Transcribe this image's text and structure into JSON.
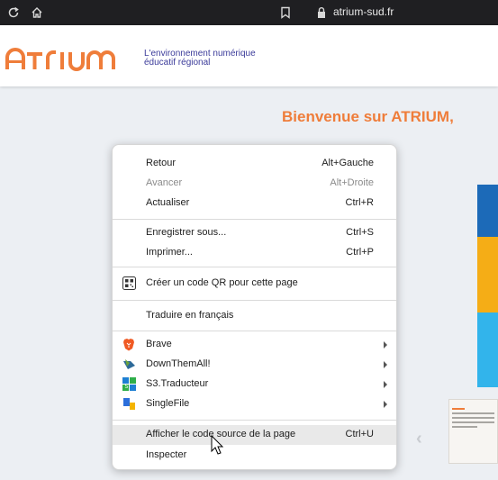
{
  "toolbar": {
    "url": "atrium-sud.fr",
    "icons": [
      "reload-icon",
      "home-icon",
      "bookmark-icon",
      "lock-icon"
    ]
  },
  "header": {
    "logo_text": "ATRIUM",
    "tagline_line1": "L'environnement numérique",
    "tagline_line2": "éducatif régional"
  },
  "main": {
    "welcome": "Bienvenue sur ATRIUM,"
  },
  "context_menu": {
    "items": [
      {
        "label": "Retour",
        "shortcut": "Alt+Gauche"
      },
      {
        "label": "Avancer",
        "shortcut": "Alt+Droite",
        "disabled": true
      },
      {
        "label": "Actualiser",
        "shortcut": "Ctrl+R"
      },
      {
        "label": "Enregistrer sous...",
        "shortcut": "Ctrl+S"
      },
      {
        "label": "Imprimer...",
        "shortcut": "Ctrl+P"
      },
      {
        "label": "Créer un code QR pour cette page",
        "icon": "qr-code-icon"
      },
      {
        "label": "Traduire en français"
      },
      {
        "label": "Brave",
        "icon": "brave-lion-icon",
        "submenu": true
      },
      {
        "label": "DownThemAll!",
        "icon": "downthemall-icon",
        "submenu": true
      },
      {
        "label": "S3.Traducteur",
        "icon": "s3-translator-icon",
        "submenu": true
      },
      {
        "label": "SingleFile",
        "icon": "singlefile-icon",
        "submenu": true
      },
      {
        "label": "Afficher le code source de la page",
        "shortcut": "Ctrl+U",
        "hovered": true
      },
      {
        "label": "Inspecter"
      }
    ]
  },
  "colors": {
    "brand_orange": "#ef7d3a",
    "brand_navy": "#3b3b9a",
    "block_blue": "#1c6ab8",
    "block_yellow": "#f5ad16",
    "block_cyan": "#32b4eb"
  }
}
